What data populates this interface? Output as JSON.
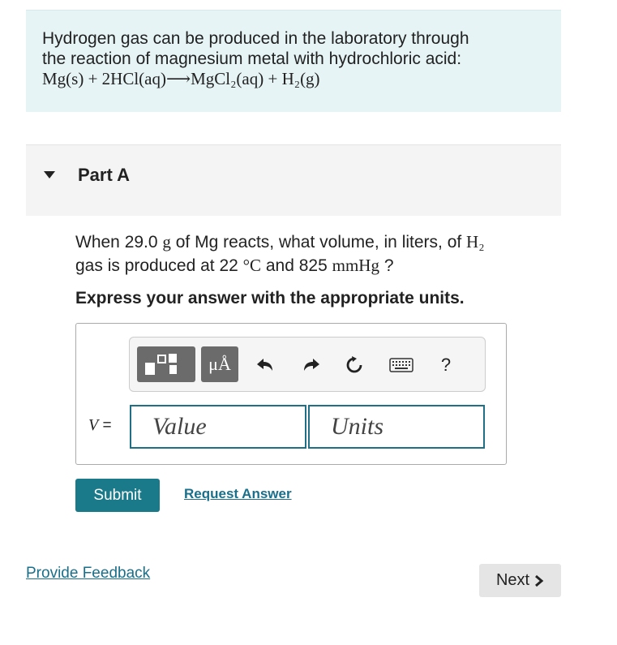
{
  "intro": {
    "line1": "Hydrogen gas can be produced in the laboratory through",
    "line2": "the reaction of magnesium metal with hydrochloric acid:",
    "equation": "Mg(s) + 2HCl(aq)⟶MgCl₂(aq) + H₂(g)"
  },
  "part": {
    "label": "Part A"
  },
  "question": {
    "line1_a": "When 29.0 ",
    "mass_unit": "g",
    "line1_b": " of Mg reacts, what volume, in liters, of ",
    "species": "H₂",
    "line2_a": "gas is produced at 22 ",
    "temp_unit": "°C",
    "line2_b": " and 825 ",
    "pressure_unit": "mmHg",
    "line2_c": " ?"
  },
  "instruction": "Express your answer with the appropriate units.",
  "toolbar": {
    "units_symbol": "μÅ",
    "help_symbol": "?"
  },
  "answer": {
    "variable": "V",
    "equals": "=",
    "value_placeholder": "Value",
    "units_placeholder": "Units"
  },
  "actions": {
    "submit": "Submit",
    "request_answer": "Request Answer"
  },
  "footer": {
    "feedback": "Provide Feedback",
    "next": "Next"
  }
}
